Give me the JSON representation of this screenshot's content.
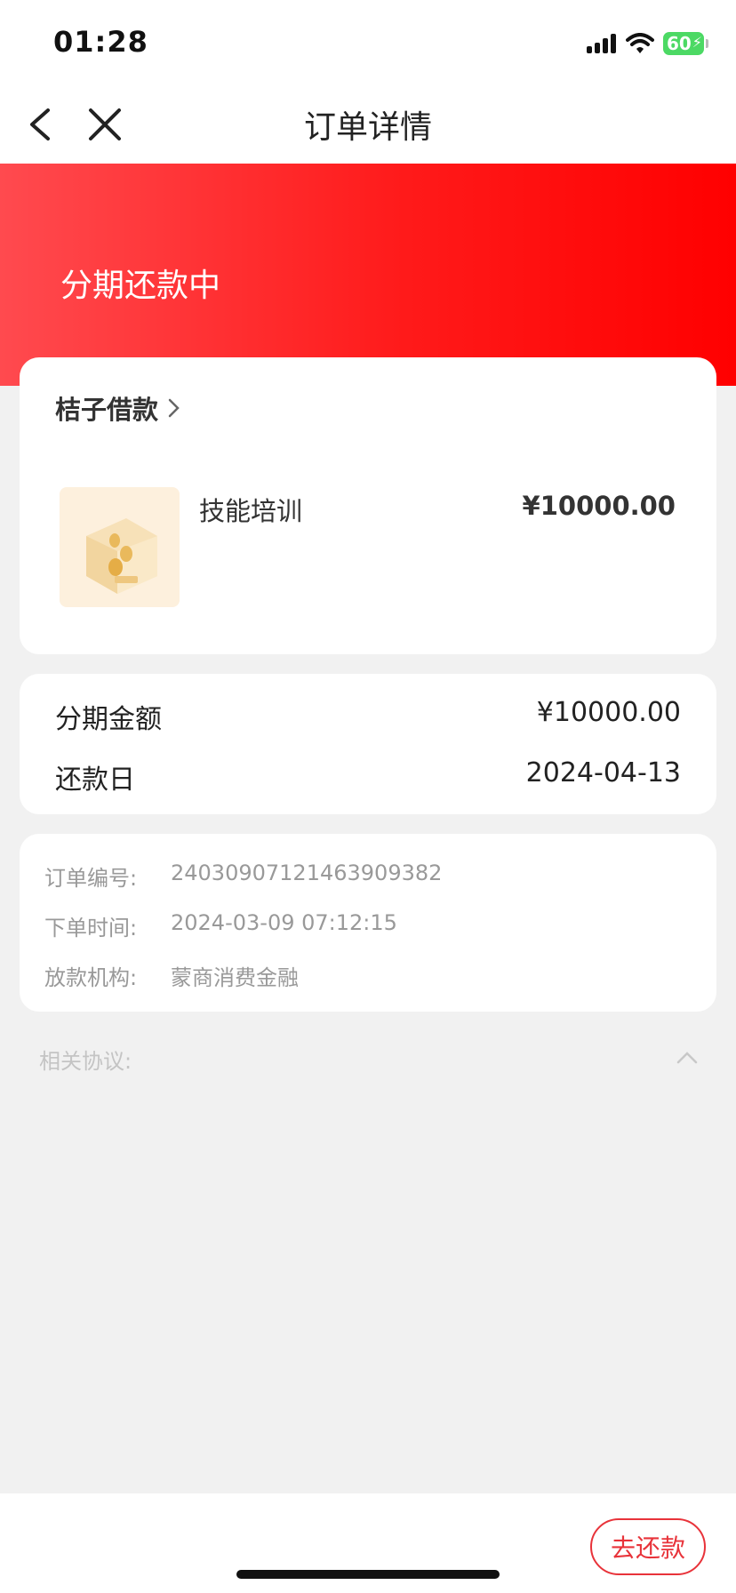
{
  "status_bar": {
    "time": "01:28",
    "battery": "60"
  },
  "nav": {
    "title": "订单详情"
  },
  "banner": {
    "status": "分期还款中"
  },
  "order_card": {
    "lender": "桔子借款",
    "product_name": "技能培训",
    "product_price": "¥10000.00"
  },
  "amount_card": {
    "installment_label": "分期金额",
    "installment_value": "¥10000.00",
    "due_label": "还款日",
    "due_value": "2024-04-13"
  },
  "info_card": {
    "order_no_label": "订单编号:",
    "order_no_value": "24030907121463909382",
    "order_time_label": "下单时间:",
    "order_time_value": "2024-03-09 07:12:15",
    "lender_org_label": "放款机构:",
    "lender_org_value": "蒙商消费金融"
  },
  "agreements": {
    "label": "相关协议:"
  },
  "bottom": {
    "pay_button": "去还款"
  },
  "colors": {
    "brand_red": "#ff1a1a",
    "button_red": "#e8333a",
    "battery_green": "#4cd964"
  },
  "icons": [
    "signal-icon",
    "wifi-icon",
    "battery-icon",
    "back-icon",
    "close-icon",
    "chevron-right-icon",
    "product-thumbnail",
    "chevron-up-icon"
  ]
}
